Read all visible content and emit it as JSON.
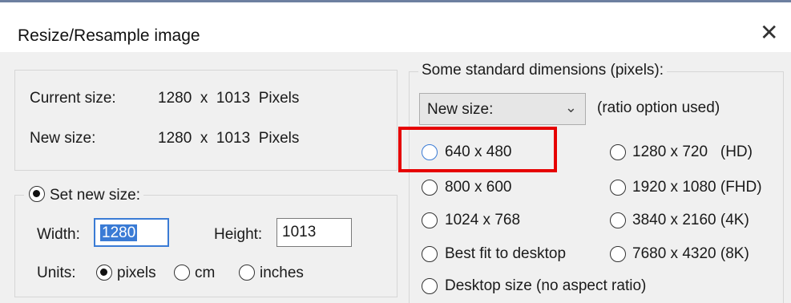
{
  "window": {
    "title": "Resize/Resample image",
    "close_glyph": "✕"
  },
  "sizes": {
    "current_label": "Current size:",
    "current_value": "1280  x  1013  Pixels",
    "new_label": "New size:",
    "new_value": "1280  x  1013  Pixels"
  },
  "set_new_size": {
    "label": "Set new size:",
    "selected": true,
    "width_label": "Width:",
    "width_value": "1280",
    "height_label": "Height:",
    "height_value": "1013",
    "units_label": "Units:",
    "units": [
      {
        "label": "pixels",
        "selected": true
      },
      {
        "label": "cm",
        "selected": false
      },
      {
        "label": "inches",
        "selected": false
      }
    ]
  },
  "standard": {
    "legend": "Some standard dimensions (pixels):",
    "dropdown_value": "New size:",
    "ratio_note": "(ratio option used)",
    "options": [
      {
        "label": "640 x 480"
      },
      {
        "label": "1280 x 720   (HD)"
      },
      {
        "label": "800 x 600"
      },
      {
        "label": "1920 x 1080 (FHD)"
      },
      {
        "label": "1024 x 768"
      },
      {
        "label": "3840 x 2160 (4K)"
      },
      {
        "label": "Best fit to desktop"
      },
      {
        "label": "7680 x 4320 (8K)"
      },
      {
        "label": "Desktop size (no aspect ratio)"
      }
    ]
  },
  "colors": {
    "accent": "#3a7bd5",
    "highlight_box": "#e60000",
    "dialog_bg": "#f0f0f0"
  }
}
